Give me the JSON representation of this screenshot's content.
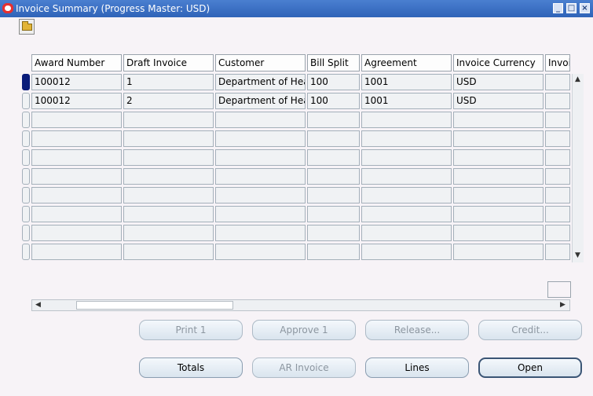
{
  "window": {
    "title": "Invoice Summary (Progress Master: USD)",
    "controls": [
      "minimize-icon",
      "maximize-icon",
      "close-icon"
    ]
  },
  "table": {
    "columns": [
      "Award Number",
      "Draft Invoice",
      "Customer",
      "Bill Split",
      "Agreement",
      "Invoice Currency",
      "Invoi"
    ],
    "rows": [
      [
        "100012",
        "1",
        "Department of Heal",
        "100",
        "1001",
        "USD",
        ""
      ],
      [
        "100012",
        "2",
        "Department of Heal",
        "100",
        "1001",
        "USD",
        ""
      ]
    ],
    "empty_rows": 8
  },
  "buttons": {
    "print": "Print 1",
    "approve": "Approve 1",
    "release": "Release...",
    "credit": "Credit...",
    "totals": "Totals",
    "ar_invoice": "AR Invoice",
    "lines": "Lines",
    "open": "Open"
  },
  "colors": {
    "title_bar": "#2f63b8",
    "selected_row": "#0a1c7a"
  }
}
